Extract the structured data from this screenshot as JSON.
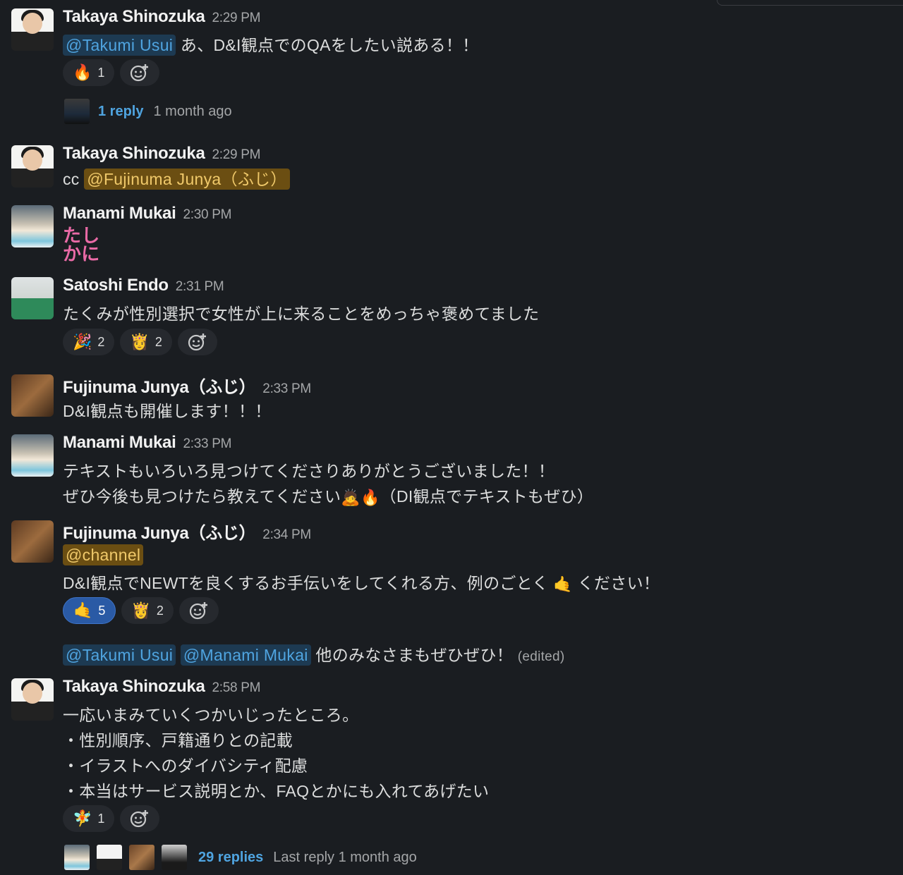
{
  "messages": [
    {
      "sender": "Takaya Shinozuka",
      "time": "2:29 PM",
      "mention": "@Takumi Usui",
      "text": "あ、D&I観点でのQAをしたい説ある！！",
      "reactions": [
        {
          "emoji": "🔥",
          "icon": "fire-icon",
          "count": "1"
        }
      ],
      "thread": {
        "replies": "1 reply",
        "meta": "1 month ago"
      }
    },
    {
      "sender": "Takaya Shinozuka",
      "time": "2:29 PM",
      "prefix": "cc",
      "mention": "@Fujinuma Junya（ふじ）"
    },
    {
      "sender": "Manami Mukai",
      "time": "2:30 PM",
      "lines": [
        "たし",
        "かに"
      ]
    },
    {
      "sender": "Satoshi Endo",
      "time": "2:31 PM",
      "text": "たくみが性別選択で女性が上に来ることをめっちゃ褒めてました",
      "reactions": [
        {
          "emoji": "🎉",
          "icon": "party-icon",
          "count": "2"
        },
        {
          "emoji": "👸",
          "icon": "person-veil-icon",
          "count": "2"
        }
      ]
    },
    {
      "sender": "Fujinuma Junya（ふじ）",
      "time": "2:33 PM",
      "text": "D&I観点も開催します！！！"
    },
    {
      "sender": "Manami Mukai",
      "time": "2:33 PM",
      "line1": "テキストもいろいろ見つけてくださりありがとうございました！！",
      "line2_a": "ぜひ今後も見つけたら教えてください",
      "line2_emoji1": "🙇",
      "line2_emoji2": "🔥",
      "line2_b": "（DI観点でテキストもぜひ）"
    },
    {
      "sender": "Fujinuma Junya（ふじ）",
      "time": "2:34 PM",
      "mention": "@channel",
      "text_a": "D&I観点でNEWTを良くするお手伝いをしてくれる方、例のごとく",
      "text_emoji": "🤙",
      "text_b": "ください！",
      "reactions": [
        {
          "emoji": "🤙",
          "icon": "shaka-icon",
          "count": "5",
          "active": true
        },
        {
          "emoji": "👸",
          "icon": "person-veil-icon",
          "count": "2"
        }
      ],
      "followup": {
        "mention1": "@Takumi Usui",
        "mention2": "@Manami Mukai",
        "text": "他のみなさまもぜひぜひ！",
        "edited": "(edited)"
      }
    },
    {
      "sender": "Takaya Shinozuka",
      "time": "2:58 PM",
      "lines": [
        "一応いまみていくつかいじったところ。",
        "・性別順序、戸籍通りとの記載",
        "・イラストへのダイバシティ配慮",
        "・本当はサービス説明とか、FAQとかにも入れてあげたい"
      ],
      "reactions": [
        {
          "emoji": "🧚",
          "icon": "fairy-icon",
          "count": "1"
        }
      ],
      "thread": {
        "replies": "29 replies",
        "meta": "Last reply 1 month ago"
      }
    }
  ]
}
